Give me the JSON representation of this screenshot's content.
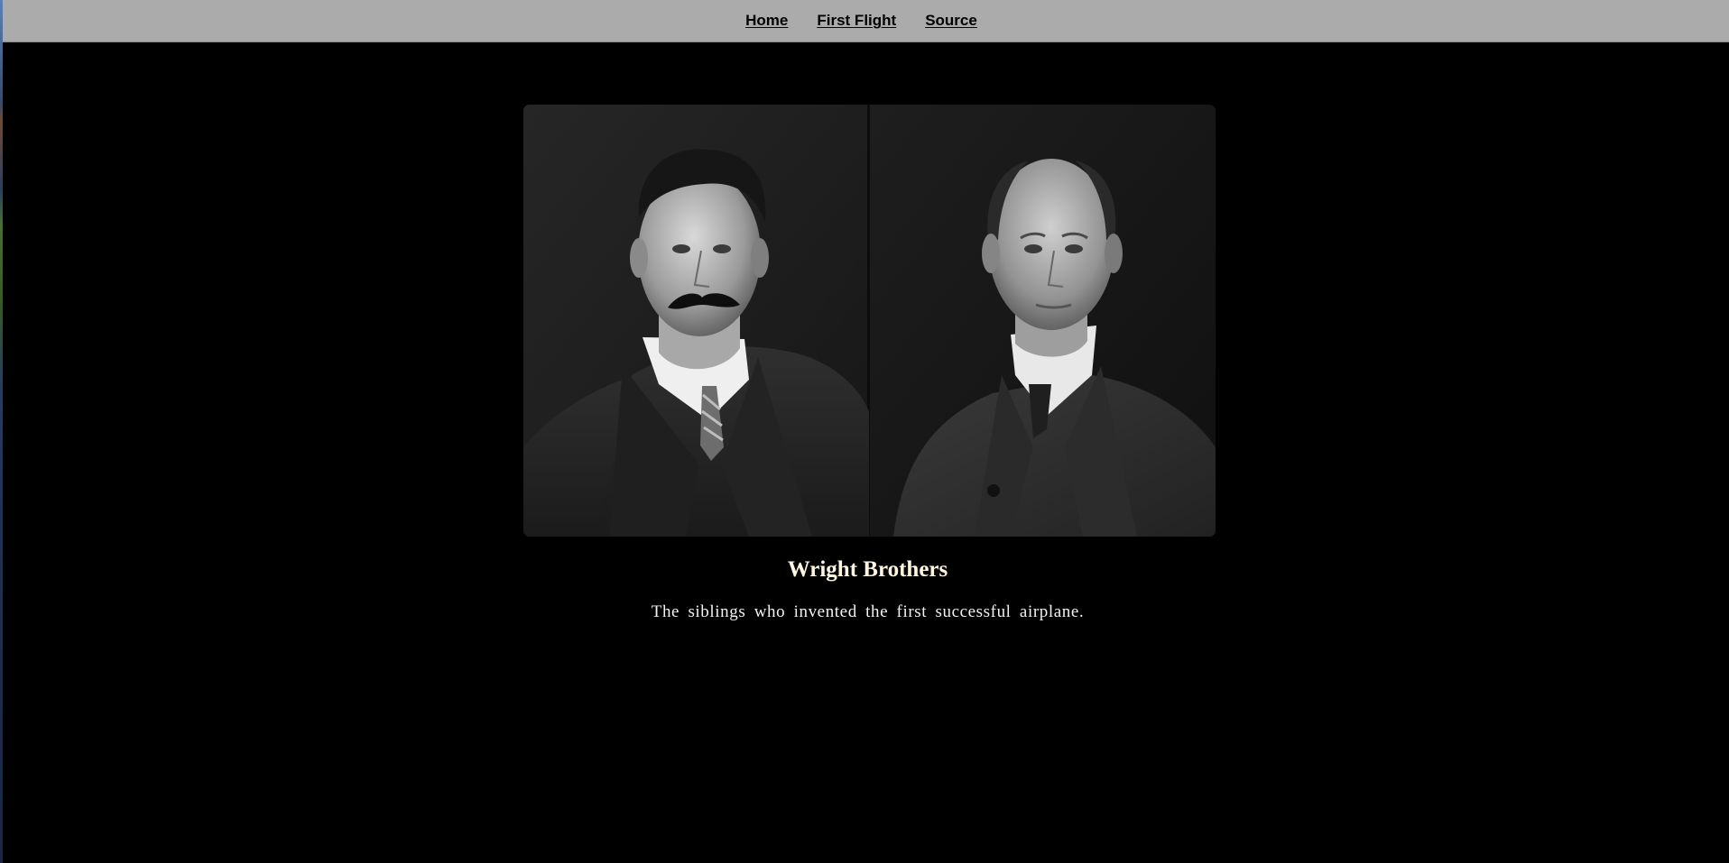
{
  "nav": {
    "items": [
      {
        "label": "Home"
      },
      {
        "label": "First Flight"
      },
      {
        "label": "Source"
      }
    ]
  },
  "hero": {
    "image_icon": "portrait-photo-icon"
  },
  "caption": {
    "title": "Wright Brothers",
    "text": "The siblings who invented the first successful airplane."
  },
  "colors": {
    "page_background": "#000000",
    "navbar_background": "#ababab",
    "title_color": "#fff6e2",
    "text_color": "#f2f2f2"
  }
}
